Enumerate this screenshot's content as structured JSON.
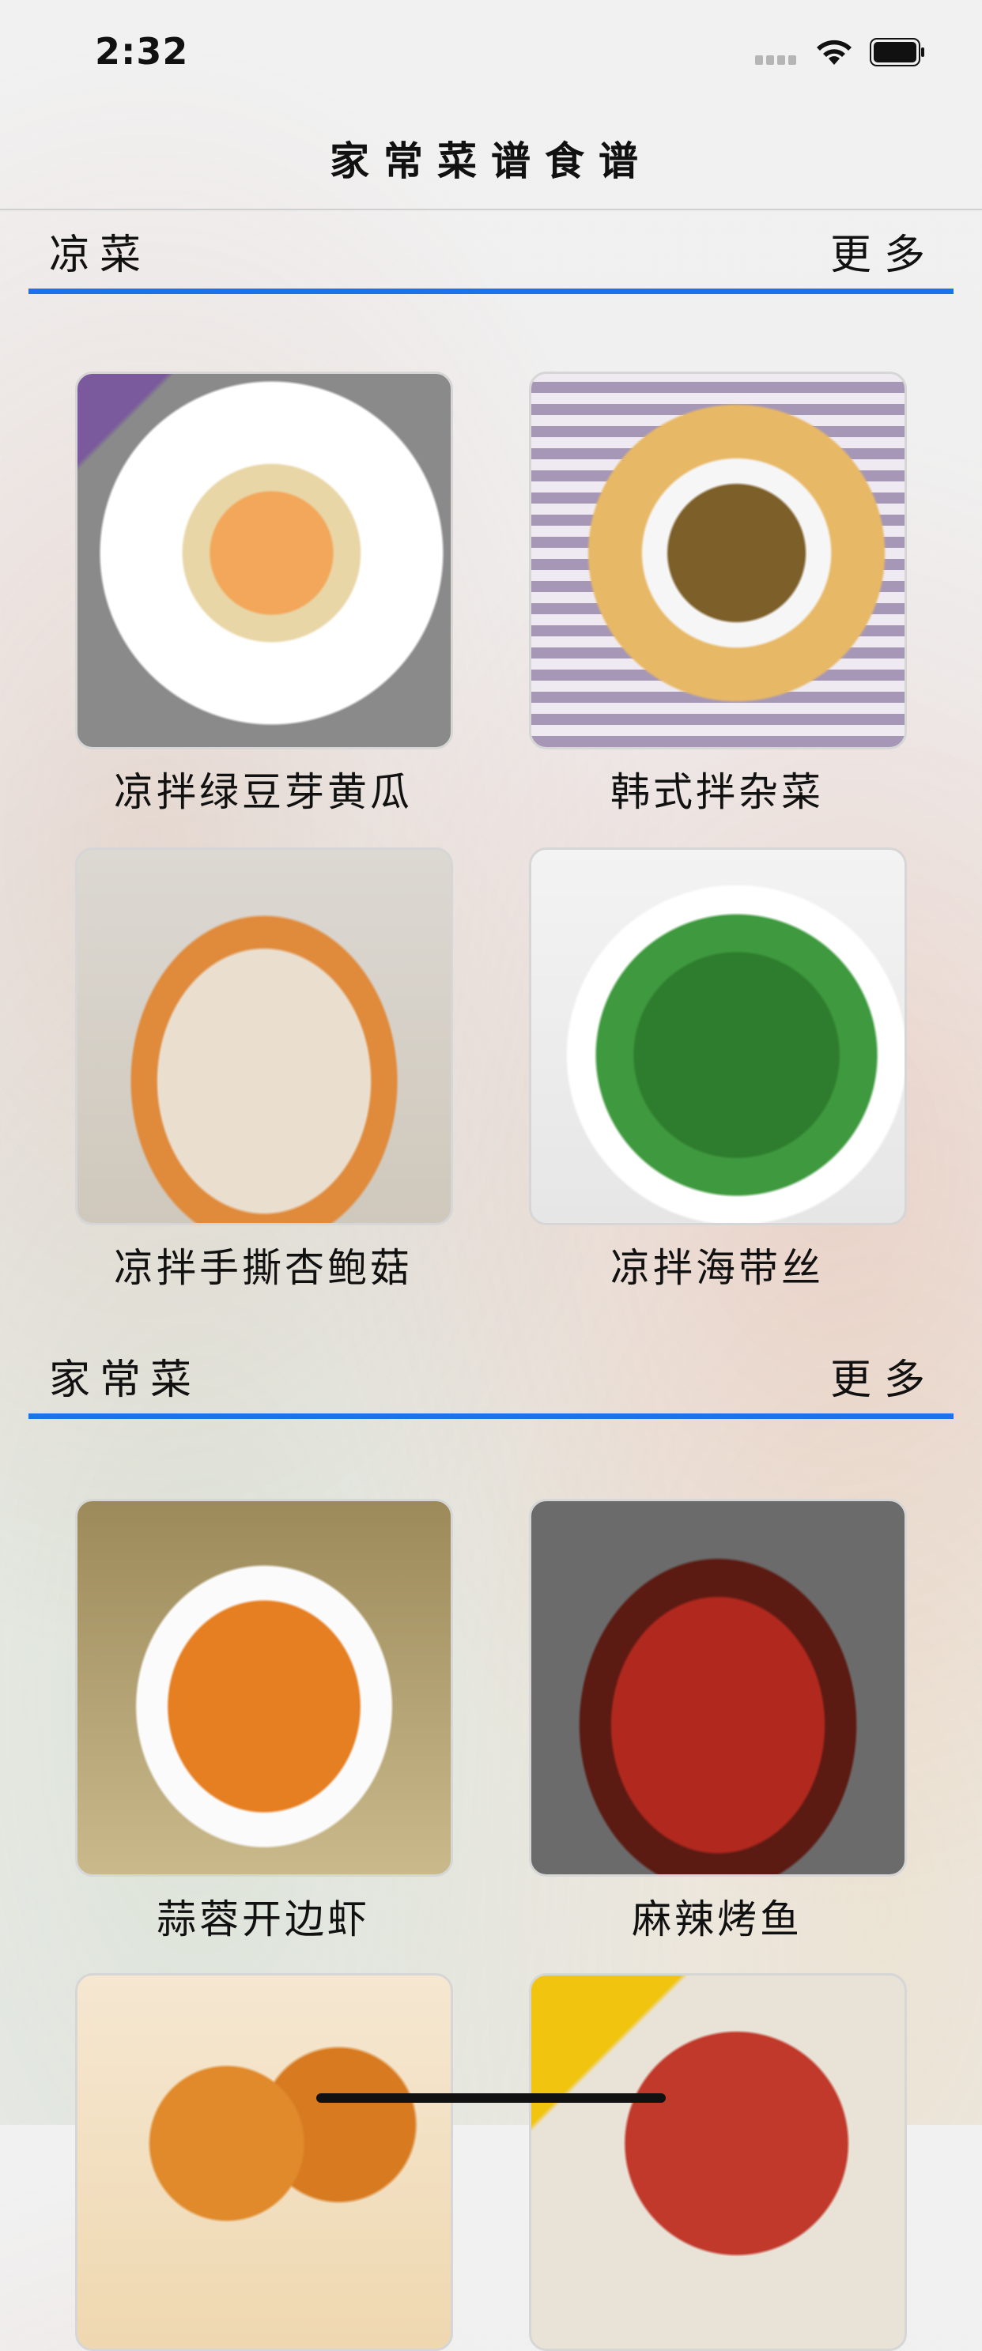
{
  "status_bar": {
    "time": "2:32"
  },
  "nav": {
    "title": "家常菜谱食谱"
  },
  "sections": [
    {
      "title": "凉菜",
      "more": "更多",
      "items": [
        {
          "name": "凉拌绿豆芽黄瓜"
        },
        {
          "name": "韩式拌杂菜"
        },
        {
          "name": "凉拌手撕杏鲍菇"
        },
        {
          "name": "凉拌海带丝"
        }
      ]
    },
    {
      "title": "家常菜",
      "more": "更多",
      "items": [
        {
          "name": "蒜蓉开边虾"
        },
        {
          "name": "麻辣烤鱼"
        },
        {
          "name": ""
        },
        {
          "name": ""
        }
      ]
    }
  ],
  "colors": {
    "accent_line": "#1a73e8"
  },
  "icons": [
    "cellular-signal-icon",
    "wifi-icon",
    "battery-icon"
  ]
}
